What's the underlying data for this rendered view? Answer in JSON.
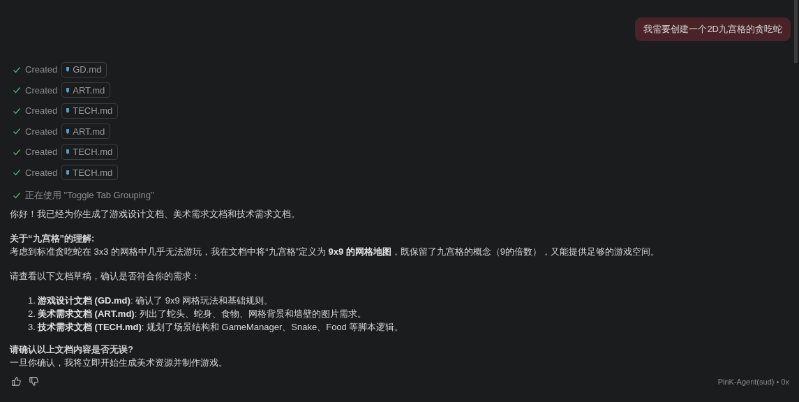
{
  "user_message": {
    "text": "我需要创建一个2D九宫格的贪吃蛇"
  },
  "steps": [
    {
      "kind": "file",
      "done": true,
      "action": "Created",
      "file": "GD.md"
    },
    {
      "kind": "file",
      "done": true,
      "action": "Created",
      "file": "ART.md"
    },
    {
      "kind": "file",
      "done": true,
      "action": "Created",
      "file": "TECH.md"
    },
    {
      "kind": "file",
      "done": true,
      "action": "Created",
      "file": "ART.md"
    },
    {
      "kind": "file",
      "done": true,
      "action": "Created",
      "file": "TECH.md"
    },
    {
      "kind": "file",
      "done": true,
      "action": "Created",
      "file": "TECH.md"
    },
    {
      "kind": "tool",
      "done": true,
      "action": "正在使用 \"Toggle Tab Grouping\""
    }
  ],
  "response": [
    {
      "kind": "p",
      "text": "你好！我已经为你生成了游戏设计文档、美术需求文档和技术需求文档。"
    },
    {
      "kind": "section",
      "heading": "关于“九宫格”的理解:",
      "text": "考虑到标准贪吃蛇在 3x3 的网格中几乎无法游玩，我在文档中将“九宫格”定义为 **9x9 的网格地图**，既保留了九宫格的概念（9的倍数），又能提供足够的游戏空间。"
    },
    {
      "kind": "p",
      "text": "请查看以下文档草稿，确认是否符合你的需求："
    },
    {
      "kind": "ol",
      "items": [
        {
          "number": "1.",
          "text": "**游戏设计文档 (GD.md)**: 确认了 9x9 网格玩法和基础规则。"
        },
        {
          "number": "2.",
          "text": "**美术需求文档 (ART.md)**: 列出了蛇头、蛇身、食物、网格背景和墙壁的图片需求。"
        },
        {
          "number": "3.",
          "text": "**技术需求文档 (TECH.md)**: 规划了场景结构和 GameManager、Snake、Food 等脚本逻辑。"
        }
      ]
    },
    {
      "kind": "section",
      "heading": "请确认以上文档内容是否无误?",
      "text": "一旦你确认，我将立即开始生成美术资源并制作游戏。"
    }
  ],
  "footer": {
    "agent": "PinK-Agent(sud) • 0x"
  }
}
